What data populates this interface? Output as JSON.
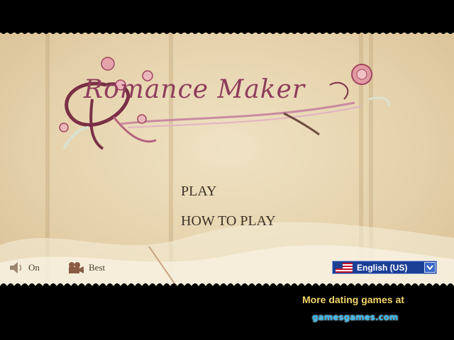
{
  "game": {
    "title_logo": "Romance Maker"
  },
  "menu": {
    "play": "PLAY",
    "how_to_play": "HOW TO PLAY"
  },
  "controls": {
    "sound_label": "On",
    "quality_label": "Best",
    "sound_icon": "speaker-icon",
    "quality_icon": "camera-icon"
  },
  "language": {
    "selected": "English (US)",
    "flag": "us-flag-icon"
  },
  "promo": {
    "more_games": "More dating games at",
    "brand": "gamesgames.com"
  },
  "colors": {
    "parchment": "#e6d3ad",
    "logo_pink": "#8e3d5c",
    "menu_text": "#3d3226",
    "promo_yellow": "#f2d566",
    "brand_blue": "#2fb8f2",
    "select_blue": "#1c3f96"
  }
}
